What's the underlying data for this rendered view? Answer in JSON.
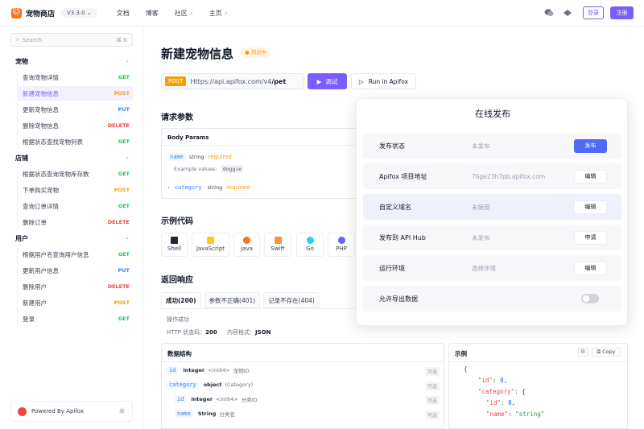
{
  "header": {
    "brand": "宠物商店",
    "version": "V3.3.0",
    "nav": [
      {
        "label": "文档",
        "external": false
      },
      {
        "label": "博客",
        "external": false
      },
      {
        "label": "社区",
        "external": true
      },
      {
        "label": "主页",
        "external": true
      }
    ],
    "login": "登录",
    "register": "注册"
  },
  "sidebar": {
    "search_placeholder": "Search",
    "search_shortcut": "⌘ K",
    "groups": [
      {
        "label": "宠物",
        "items": [
          {
            "label": "查询宠物详情",
            "method": "GET"
          },
          {
            "label": "新建宠物信息",
            "method": "POST",
            "active": true
          },
          {
            "label": "更新宠物信息",
            "method": "PUT"
          },
          {
            "label": "删除宠物信息",
            "method": "DELETE"
          },
          {
            "label": "根据状态查找宠物列表",
            "method": "GET"
          }
        ]
      },
      {
        "label": "店铺",
        "items": [
          {
            "label": "根据状态查询宠物库存数",
            "method": "GET"
          },
          {
            "label": "下单购买宠物",
            "method": "POST"
          },
          {
            "label": "查询订单详情",
            "method": "GET"
          },
          {
            "label": "删除订单",
            "method": "DELETE"
          }
        ]
      },
      {
        "label": "用户",
        "items": [
          {
            "label": "根据用户名查询用户信息",
            "method": "GET"
          },
          {
            "label": "更新用户信息",
            "method": "PUT"
          },
          {
            "label": "删除用户",
            "method": "DELETE"
          },
          {
            "label": "新建用户",
            "method": "POST"
          },
          {
            "label": "登录",
            "method": "GET"
          }
        ]
      }
    ],
    "powered_by": "Powered By Apifox"
  },
  "main": {
    "title": "新建宠物信息",
    "status_tag": "测试中",
    "method": "POST",
    "url_base": "Https://api.apifox.com/v4",
    "url_path": "/pet",
    "debug_button": "调试",
    "run_button": "Run in Apifox",
    "request_params_title": "请求参数",
    "body_params": {
      "label": "Body Params",
      "fields": [
        {
          "name": "name",
          "type": "string",
          "required": "required",
          "example_label": "Example values:",
          "example": "doggie"
        },
        {
          "name": "category",
          "type": "string",
          "required": "required"
        }
      ]
    },
    "example_code_title": "示例代码",
    "languages": [
      "Shell",
      "JavaScript",
      "Java",
      "Swift",
      "Go",
      "PHP"
    ],
    "response_title": "返回响应",
    "response_tabs": [
      "成功(200)",
      "参数不正确(401)",
      "记录不存在(404)"
    ],
    "response_desc": "操作成功",
    "http_status_label": "HTTP 状态码：",
    "http_status": "200",
    "content_format_label": "内容格式：",
    "content_format": "JSON",
    "data_structure_title": "数据结构",
    "data_rows": [
      {
        "name": "id",
        "type": "integer",
        "format": "<int64>",
        "desc": "宠物ID",
        "opt": "可选",
        "indent": 0
      },
      {
        "name": "category",
        "type": "object",
        "format": "(Category)",
        "desc": "",
        "opt": "可选",
        "indent": 0
      },
      {
        "name": "id",
        "type": "integer",
        "format": "<int64>",
        "desc": "分类ID",
        "opt": "可选",
        "indent": 1
      },
      {
        "name": "name",
        "type": "String",
        "format": "",
        "desc": "分类名",
        "opt": "可选",
        "indent": 1
      }
    ],
    "example_title": "示例",
    "copy_label": "Copy"
  },
  "dialog": {
    "title": "在线发布",
    "rows": [
      {
        "label": "发布状态",
        "value": "未发布",
        "action": "发布",
        "primary": true
      },
      {
        "label": "Apifox 项目地址",
        "value": "76ge23h7pb.apifox.com",
        "action": "编辑"
      },
      {
        "label": "自定义域名",
        "value": "未使用",
        "action": "编辑",
        "highlight": true
      },
      {
        "label": "发布到 API Hub",
        "value": "未发布",
        "action": "申请"
      },
      {
        "label": "运行环境",
        "value": "选择环境",
        "action": "编辑"
      },
      {
        "label": "允许导出数据",
        "value": "",
        "toggle": false
      }
    ]
  },
  "colors": {
    "accent": "#7c5cfc",
    "get": "#22c55e",
    "post": "#f59e0b",
    "put": "#3b82f6",
    "delete": "#ef4444"
  }
}
